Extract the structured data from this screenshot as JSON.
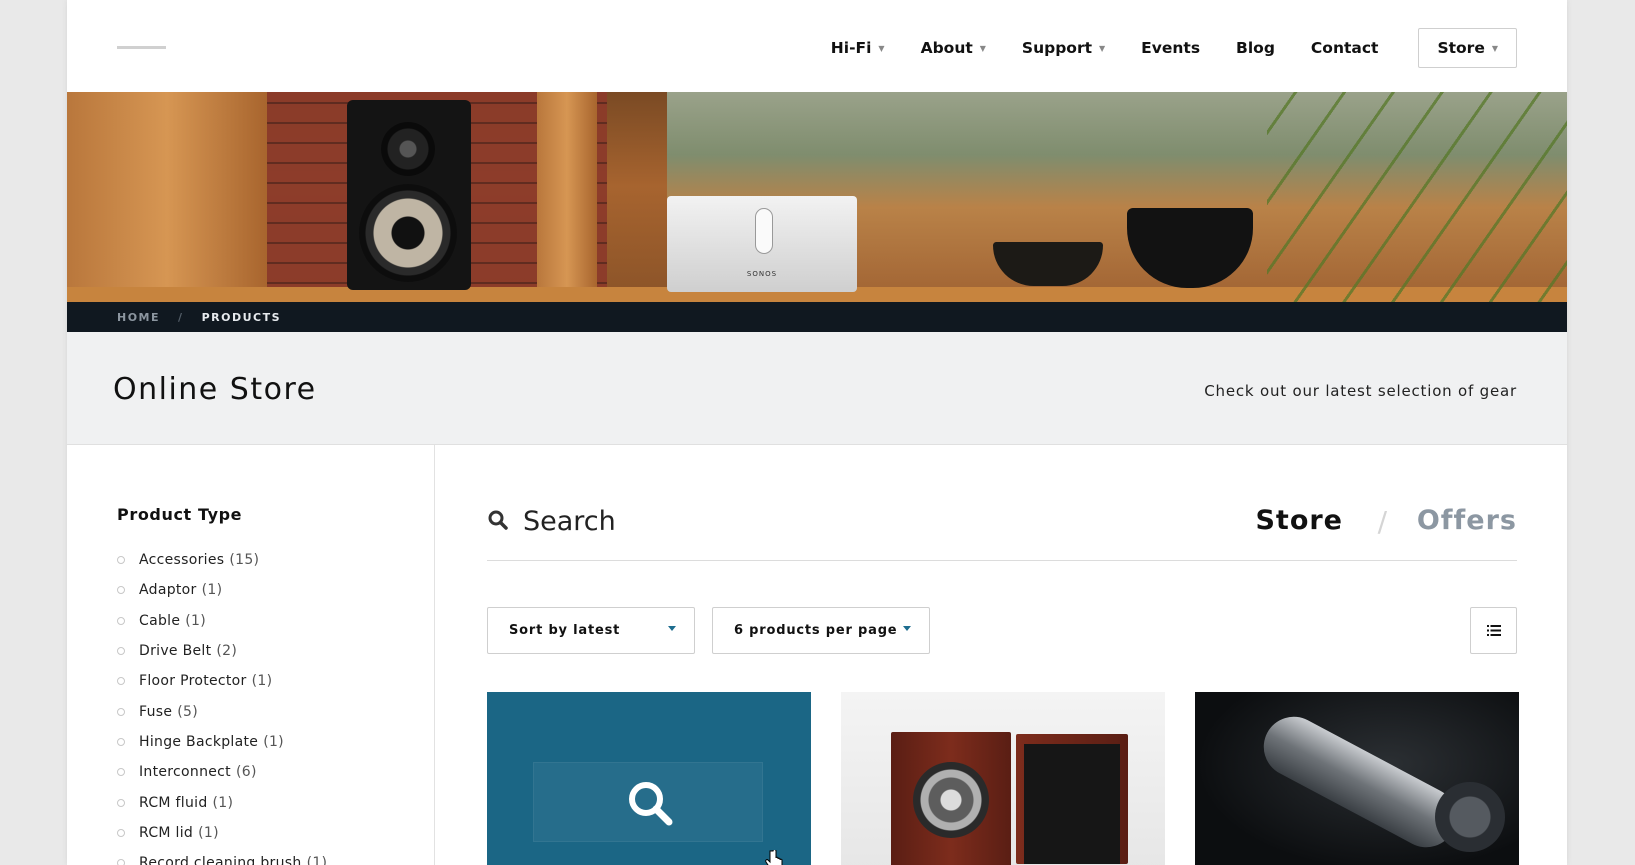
{
  "nav": {
    "items": [
      {
        "label": "Hi-Fi",
        "dropdown": true
      },
      {
        "label": "About",
        "dropdown": true
      },
      {
        "label": "Support",
        "dropdown": true
      },
      {
        "label": "Events",
        "dropdown": false
      },
      {
        "label": "Blog",
        "dropdown": false
      },
      {
        "label": "Contact",
        "dropdown": false
      }
    ],
    "store": {
      "label": "Store",
      "dropdown": true
    }
  },
  "hero": {
    "speaker_brand": "SONOS"
  },
  "breadcrumb": {
    "home": "HOME",
    "separator": "/",
    "current": "PRODUCTS"
  },
  "title_band": {
    "title": "Online Store",
    "subtitle": "Check out our latest selection of gear"
  },
  "sidebar": {
    "heading": "Product Type",
    "items": [
      {
        "label": "Accessories",
        "count": "(15)"
      },
      {
        "label": "Adaptor",
        "count": "(1)"
      },
      {
        "label": "Cable",
        "count": "(1)"
      },
      {
        "label": "Drive Belt",
        "count": "(2)"
      },
      {
        "label": "Floor Protector",
        "count": "(1)"
      },
      {
        "label": "Fuse",
        "count": "(5)"
      },
      {
        "label": "Hinge Backplate",
        "count": "(1)"
      },
      {
        "label": "Interconnect",
        "count": "(6)"
      },
      {
        "label": "RCM fluid",
        "count": "(1)"
      },
      {
        "label": "RCM lid",
        "count": "(1)"
      },
      {
        "label": "Record cleaning brush",
        "count": "(1)"
      }
    ]
  },
  "main": {
    "search_placeholder": "Search",
    "tabs": {
      "store": "Store",
      "separator": "/",
      "offers": "Offers"
    },
    "sort_label": "Sort by latest",
    "per_page_label": "6 products per page"
  },
  "colors": {
    "accent": "#1e6d8f",
    "card_overlay": "#1b6685",
    "breadcrumb_bg": "#101820",
    "title_band_bg": "#f0f1f2"
  },
  "icons": [
    "search-icon",
    "list-view-icon",
    "magnifier-icon",
    "hand-cursor-icon",
    "caret-down-icon"
  ]
}
